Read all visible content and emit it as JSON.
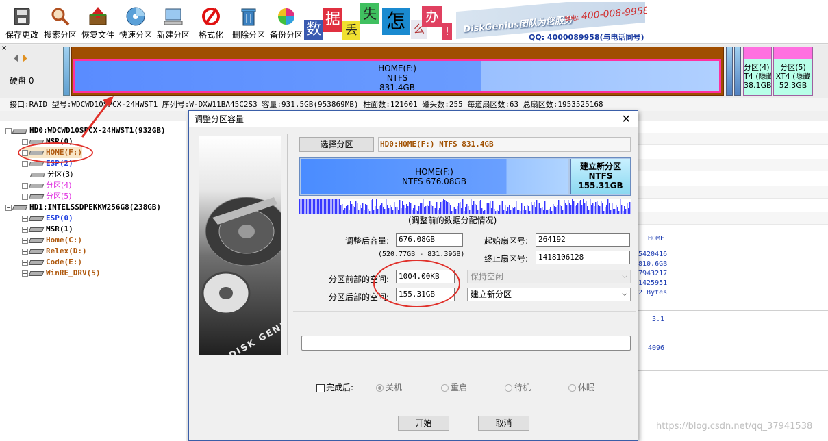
{
  "toolbar": {
    "buttons": [
      {
        "label": "保存更改",
        "icon": "save-disk-icon"
      },
      {
        "label": "搜索分区",
        "icon": "magnifier-icon"
      },
      {
        "label": "恢复文件",
        "icon": "recover-box-icon"
      },
      {
        "label": "快速分区",
        "icon": "quick-partition-disc-icon"
      },
      {
        "label": "新建分区",
        "icon": "new-partition-computer-icon"
      },
      {
        "label": "格式化",
        "icon": "format-no-icon"
      },
      {
        "label": "删除分区",
        "icon": "trash-bin-icon"
      },
      {
        "label": "备份分区",
        "icon": "backup-pie-icon"
      }
    ],
    "ad": {
      "tiles": [
        "数",
        "据",
        "丢",
        "失",
        "怎",
        "么",
        "办",
        "!"
      ],
      "brand": "DiskGenius团队为您服务",
      "phone_label": "致电:",
      "phone": "400-008-9958",
      "qq": "QQ: 4000089958(与电话同号)"
    }
  },
  "diskbar": {
    "disk_label": "硬盘 0",
    "main_partition": {
      "name": "HOME(F:)",
      "fs": "NTFS",
      "size": "831.4GB"
    },
    "small_partitions": [
      {
        "name": "分区(4)",
        "line2": "T4 (隐藏",
        "size": "38.1GB"
      },
      {
        "name": "分区(5)",
        "line2": "XT4 (隐藏",
        "size": "52.3GB"
      }
    ],
    "info": "接口:RAID  型号:WDCWD10SPCX-24HWST1  序列号:W-DXW11BA45C2S3  容量:931.5GB(953869MB)  柱面数:121601  磁头数:255  每道扇区数:63  总扇区数:1953525168"
  },
  "tree": {
    "items": [
      {
        "text": "HD0:WDCWD10SPCX-24HWST1(932GB)",
        "color": "#000000",
        "bold": true,
        "level": 0
      },
      {
        "text": "MSR(0)",
        "color": "#000000",
        "bold": true,
        "level": 1
      },
      {
        "text": "HOME(F:)",
        "color": "#b05a10",
        "bold": true,
        "level": 1
      },
      {
        "text": "ESP(2)",
        "color": "#2040e0",
        "bold": true,
        "level": 1
      },
      {
        "text": "分区(3)",
        "color": "#000000",
        "bold": false,
        "level": 1
      },
      {
        "text": "分区(4)",
        "color": "#e030e0",
        "bold": false,
        "level": 1
      },
      {
        "text": "分区(5)",
        "color": "#e030e0",
        "bold": false,
        "level": 1
      },
      {
        "text": "HD1:INTELSSDPEKKW256G8(238GB)",
        "color": "#000000",
        "bold": true,
        "level": 0
      },
      {
        "text": "ESP(0)",
        "color": "#2040e0",
        "bold": true,
        "level": 1
      },
      {
        "text": "MSR(1)",
        "color": "#000000",
        "bold": true,
        "level": 1
      },
      {
        "text": "Home(C:)",
        "color": "#b05a10",
        "bold": true,
        "level": 1
      },
      {
        "text": "Relex(D:)",
        "color": "#b05a10",
        "bold": true,
        "level": 1
      },
      {
        "text": "Code(E:)",
        "color": "#b05a10",
        "bold": true,
        "level": 1
      },
      {
        "text": "WinRE_DRV(5)",
        "color": "#b05a10",
        "bold": true,
        "level": 1
      }
    ]
  },
  "rightpanel": {
    "values": [
      "HOME",
      "5420416",
      "810.6GB",
      "7943217",
      "1425951",
      "2 Bytes",
      "3.1",
      "4096"
    ]
  },
  "dialog": {
    "title": "调整分区容量",
    "select_button": "选择分区",
    "selected_partition": "HD0:HOME(F:) NTFS 831.4GB",
    "preview": {
      "left": {
        "name": "HOME(F:)",
        "detail": "NTFS 676.08GB"
      },
      "right": {
        "name": "建立新分区",
        "fs": "NTFS",
        "size": "155.31GB"
      }
    },
    "distribution_caption": "(调整前的数据分配情况)",
    "new_size_label": "调整后容量:",
    "new_size_value": "676.08GB",
    "range_hint": "(520.77GB - 831.39GB)",
    "start_sector_label": "起始扇区号:",
    "start_sector_value": "264192",
    "end_sector_label": "终止扇区号:",
    "end_sector_value": "1418106128",
    "before_space_label": "分区前部的空间:",
    "before_space_value": "1004.00KB",
    "before_space_action": "保持空闲",
    "after_space_label": "分区后部的空间:",
    "after_space_value": "155.31GB",
    "after_space_action": "建立新分区",
    "finish_label": "完成后:",
    "radios": [
      {
        "label": "关机",
        "checked": true
      },
      {
        "label": "重启",
        "checked": false
      },
      {
        "label": "待机",
        "checked": false
      },
      {
        "label": "休眠",
        "checked": false
      }
    ],
    "start_button": "开始",
    "cancel_button": "取消",
    "image_caption": "DISK GENIUS"
  },
  "watermark": "https://blog.csdn.net/qq_37941538"
}
